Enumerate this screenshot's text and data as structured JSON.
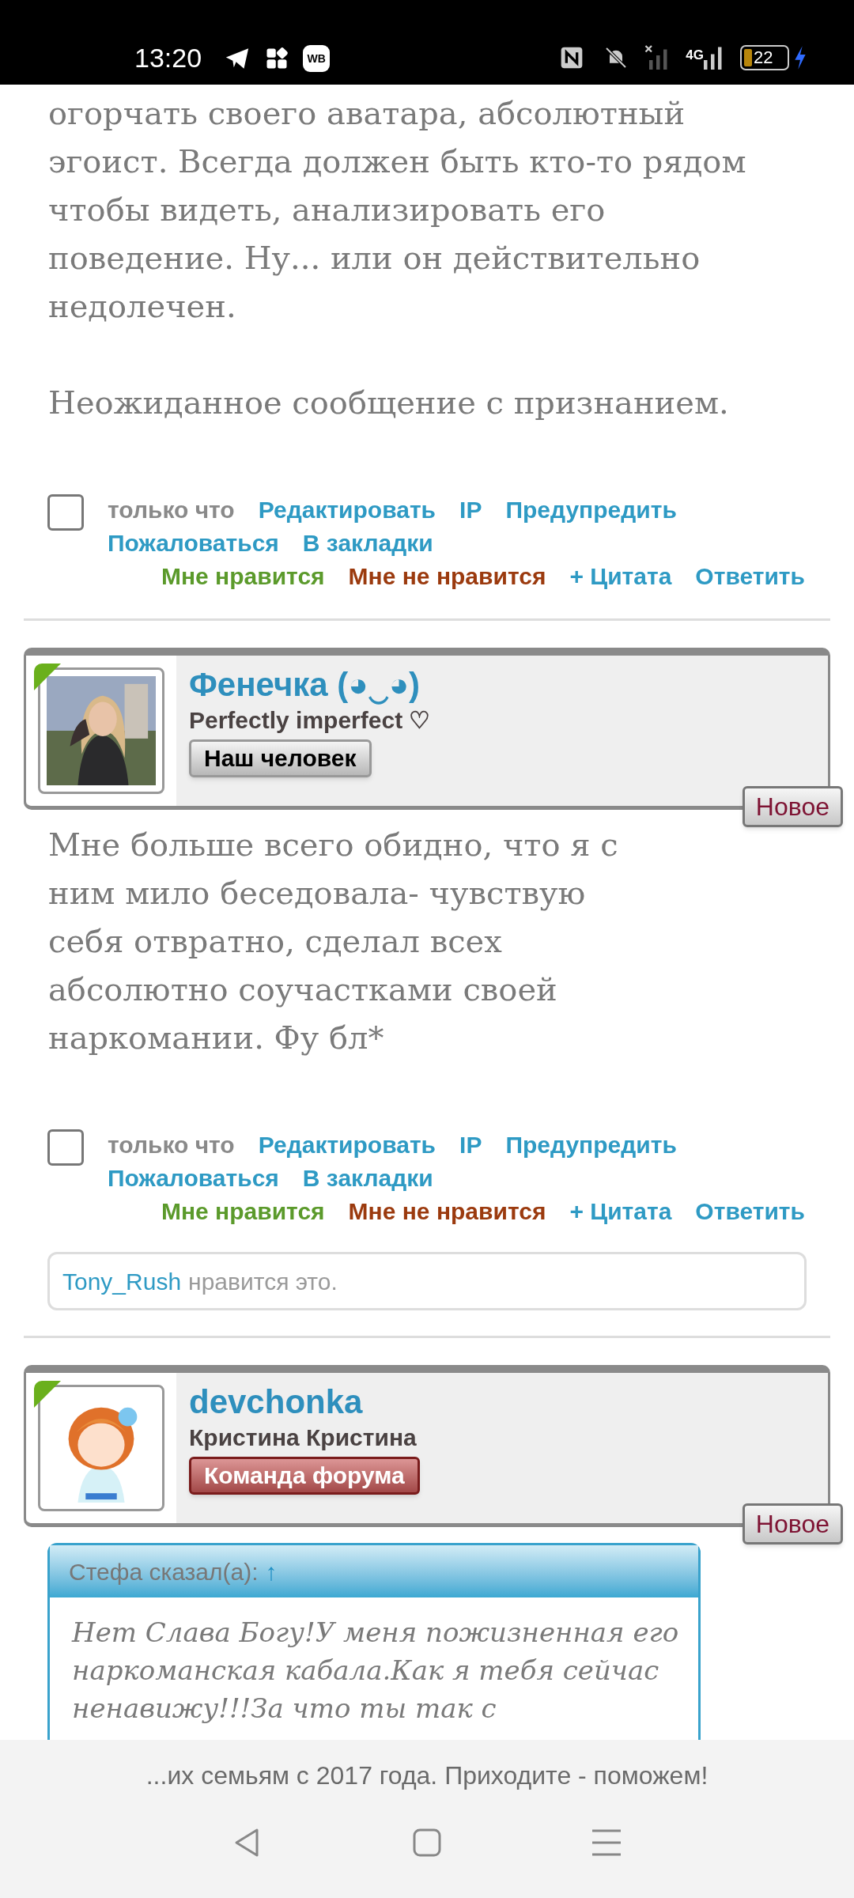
{
  "status_bar": {
    "time": "13:20",
    "app_badge": "WB",
    "network": "4G",
    "battery": "22"
  },
  "posts": [
    {
      "paragraphs": [
        [
          "огорчать своего аватара, абсолютный",
          "эгоист. Всегда должен быть кто-то рядом",
          "чтобы видеть, анализировать его",
          "поведение. Ну... или он действительно",
          "недолечен."
        ],
        [
          "Неожиданное сообщение с признанием."
        ]
      ],
      "footer": {
        "checked": false,
        "time": "только что",
        "links": [
          "Редактировать",
          "IP",
          "Предупредить",
          "Пожаловаться",
          "В закладки"
        ],
        "votes": [
          {
            "label": "Мне нравится",
            "kind": "like"
          },
          {
            "label": "Мне не нравится",
            "kind": "dislike"
          },
          {
            "label": "+ Цитата",
            "kind": "link"
          },
          {
            "label": "Ответить",
            "kind": "link"
          }
        ]
      }
    },
    {
      "author": {
        "name": "Фенечка (◕‿◕)",
        "status": "Perfectly imperfect ♡",
        "role": {
          "label": "Наш человек",
          "kind": "member"
        },
        "badge": "Новое"
      },
      "paragraphs": [
        [
          "Мне больше всего обидно, что я с",
          "ним мило беседовала- чувствую",
          "себя отвратно, сделал всех",
          "абсолютно соучастками своей",
          "наркомании. Фу бл*"
        ]
      ],
      "footer": {
        "checked": false,
        "time": "только что",
        "links": [
          "Редактировать",
          "IP",
          "Предупредить",
          "Пожаловаться",
          "В закладки"
        ],
        "votes": [
          {
            "label": "Мне нравится",
            "kind": "like"
          },
          {
            "label": "Мне не нравится",
            "kind": "dislike"
          },
          {
            "label": "+ Цитата",
            "kind": "link"
          },
          {
            "label": "Ответить",
            "kind": "link"
          }
        ]
      },
      "likes": {
        "user": "Tony_Rush",
        "text": "нравится это."
      }
    },
    {
      "author": {
        "name": "devchonka",
        "status": "Кристина Кристина",
        "role": {
          "label": "Команда форума",
          "kind": "team"
        },
        "badge": "Новое"
      },
      "quote": {
        "author": "Стефа сказал(а):",
        "link": "↑",
        "lines": [
          "Нет Слава Богу!У меня пожизненная его",
          "наркоманская кабала.Как я тебя сейчас",
          "ненавижу!!!За что ты так с"
        ]
      }
    }
  ],
  "banner": "...их семьям с 2017 года. Приходите - поможем!"
}
